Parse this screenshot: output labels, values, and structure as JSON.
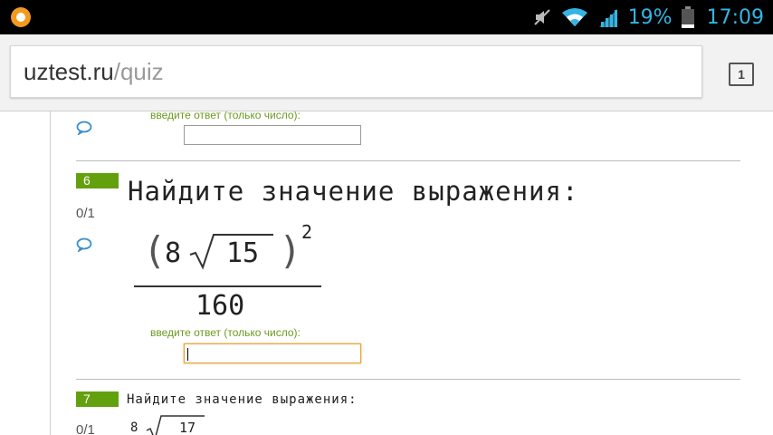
{
  "status_bar": {
    "battery_percent": "19%",
    "time": "17:09",
    "icons": [
      "app-notification-icon",
      "mute-icon",
      "wifi-icon",
      "signal-icon",
      "battery-icon"
    ]
  },
  "browser": {
    "url_host": "uztest.ru",
    "url_path": "/quiz",
    "tab_count": "1"
  },
  "quiz": {
    "answer_hint": "введите ответ (только число):",
    "questions": [
      {
        "number": "6",
        "score": "0/1",
        "prompt": "Найдите значение выражения:",
        "expr_coef": "8",
        "expr_radicand": "15",
        "expr_exponent": "2",
        "expr_denominator": "160",
        "answer_value": ""
      },
      {
        "number": "7",
        "score": "0/1",
        "prompt": "Найдите значение выражения:",
        "expr_coef": "8",
        "expr_radicand": "17"
      }
    ]
  },
  "colors": {
    "accent_green": "#63a00e",
    "hint_green": "#6a9a1f",
    "status_blue": "#33b5e5",
    "focus_orange": "#e6a23c"
  }
}
